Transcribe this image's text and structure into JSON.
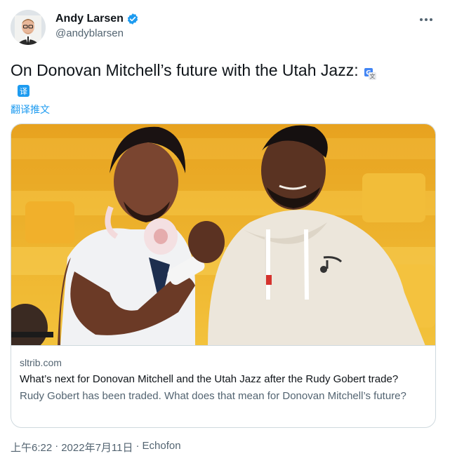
{
  "author": {
    "display_name": "Andy Larsen",
    "handle": "@andyblarsen",
    "verified": true,
    "avatar_icon": "person-avatar"
  },
  "tweet": {
    "text": "On Donovan Mitchell’s future with the Utah Jazz:",
    "translate_badge_glyph": "译",
    "translate_link": "翻译推文"
  },
  "card": {
    "image_icon": "photo-two-basketball-players",
    "domain": "sltrib.com",
    "title": "What’s next for Donovan Mitchell and the Utah Jazz after the Rudy Gobert trade?",
    "description": "Rudy Gobert has been traded. What does that mean for Donovan Mitchell’s future?"
  },
  "footer": {
    "time": "上午6:22",
    "separator": "·",
    "date": "2022年7月11日",
    "source": "Echofon"
  },
  "colors": {
    "accent": "#1d9bf0",
    "text_primary": "#0f1419",
    "text_secondary": "#536471",
    "border": "#cfd9de"
  }
}
